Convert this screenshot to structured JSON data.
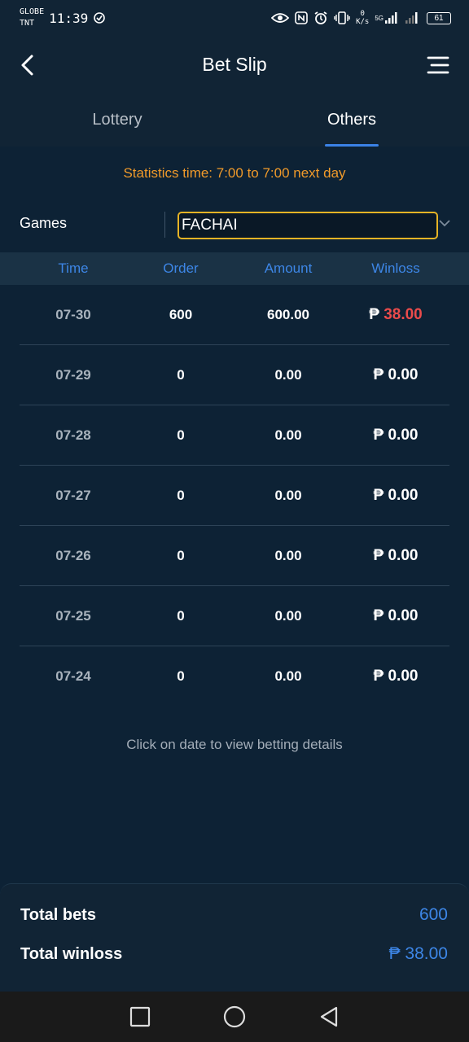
{
  "status_bar": {
    "carrier_1": "GLOBE",
    "carrier_2": "TNT",
    "time": "11:39",
    "net_speed_value": "0",
    "net_speed_unit": "K/s",
    "network_type": "5G",
    "battery": "61"
  },
  "header": {
    "title": "Bet Slip"
  },
  "tabs": [
    {
      "label": "Lottery",
      "active": false
    },
    {
      "label": "Others",
      "active": true
    }
  ],
  "statistics_notice": "Statistics time: 7:00 to 7:00 next day",
  "games_filter": {
    "label": "Games",
    "selected": "FACHAI"
  },
  "table": {
    "columns": [
      "Time",
      "Order",
      "Amount",
      "Winloss"
    ],
    "rows": [
      {
        "time": "07-30",
        "order": "600",
        "amount": "600.00",
        "currency": "₱",
        "winloss": "38.00",
        "positive": true
      },
      {
        "time": "07-29",
        "order": "0",
        "amount": "0.00",
        "currency": "₱",
        "winloss": "0.00",
        "positive": false
      },
      {
        "time": "07-28",
        "order": "0",
        "amount": "0.00",
        "currency": "₱",
        "winloss": "0.00",
        "positive": false
      },
      {
        "time": "07-27",
        "order": "0",
        "amount": "0.00",
        "currency": "₱",
        "winloss": "0.00",
        "positive": false
      },
      {
        "time": "07-26",
        "order": "0",
        "amount": "0.00",
        "currency": "₱",
        "winloss": "0.00",
        "positive": false
      },
      {
        "time": "07-25",
        "order": "0",
        "amount": "0.00",
        "currency": "₱",
        "winloss": "0.00",
        "positive": false
      },
      {
        "time": "07-24",
        "order": "0",
        "amount": "0.00",
        "currency": "₱",
        "winloss": "0.00",
        "positive": false
      }
    ]
  },
  "hint": "Click on date to view betting details",
  "summary": {
    "total_bets_label": "Total bets",
    "total_bets_value": "600",
    "total_winloss_label": "Total winloss",
    "total_winloss_value": "₱ 38.00"
  },
  "colors": {
    "accent": "#3d86e6",
    "warning": "#f09a2a",
    "positive_winloss": "#ea4b4b",
    "background": "#0d2235"
  },
  "icons": {
    "back": "chevron-left-icon",
    "menu": "hamburger-menu-icon",
    "dropdown": "chevron-down-icon",
    "nav_recents": "square-icon",
    "nav_home": "circle-icon",
    "nav_back": "triangle-back-icon"
  }
}
